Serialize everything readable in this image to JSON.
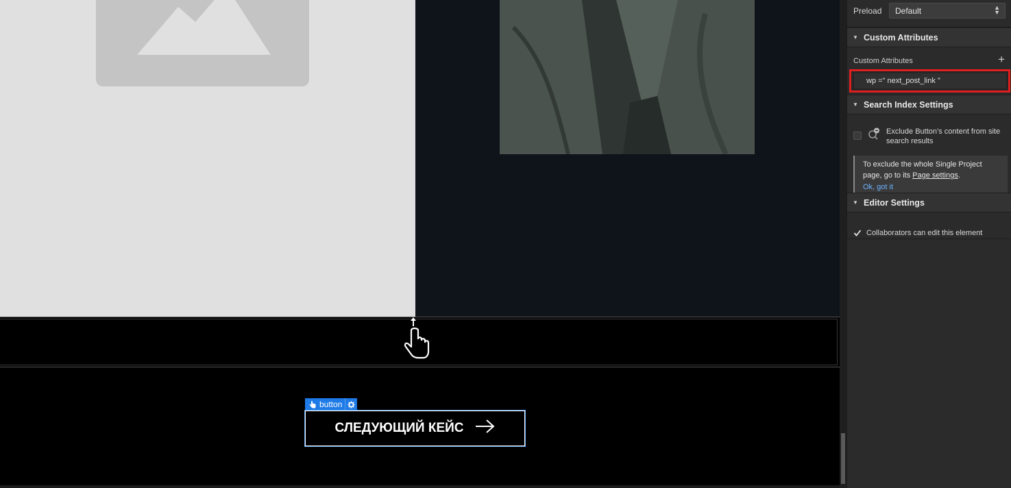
{
  "canvas": {
    "selection_tag": {
      "label": "button"
    },
    "button": {
      "label": "СЛЕДУЮЩИЙ КЕЙС"
    }
  },
  "panel": {
    "preload": {
      "label": "Preload",
      "value": "Default"
    },
    "custom_attributes": {
      "heading": "Custom Attributes",
      "label": "Custom Attributes",
      "add": "+",
      "attribute_value": "wp =\" next_post_link \""
    },
    "search_index": {
      "heading": "Search Index Settings",
      "checkbox_label": "Exclude Button’s content from site search results",
      "info_prefix": "To exclude the whole Single Project page, go to its ",
      "info_link": "Page settings",
      "info_suffix": ".",
      "ok": "Ok, got it"
    },
    "editor_settings": {
      "heading": "Editor Settings",
      "checkbox_label": "Collaborators can edit this element"
    }
  }
}
